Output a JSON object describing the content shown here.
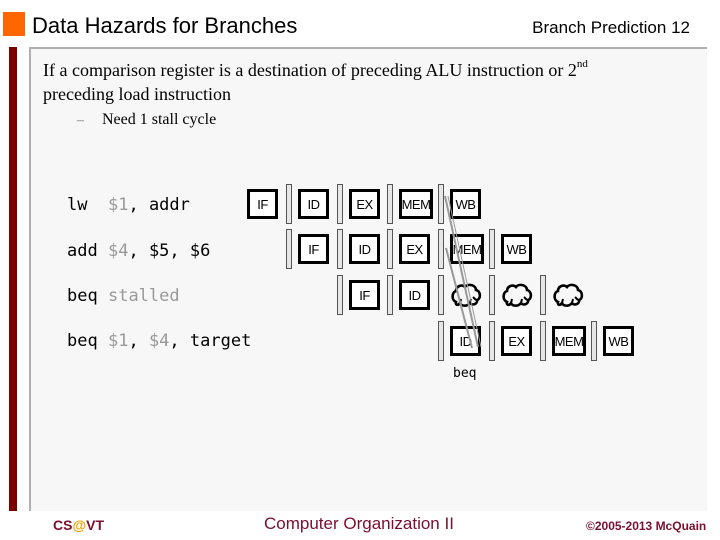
{
  "header": {
    "title": "Data Hazards for Branches",
    "section": "Branch Prediction",
    "slide_number": "12",
    "accent_color": "#ff6600",
    "bar_color": "#7a0000"
  },
  "body": {
    "bullet_line1_text": "If a comparison register is a destination of preceding ALU instruction or 2",
    "bullet_line1_sup": "nd",
    "bullet_line2": "preceding load instruction",
    "sub_dash": "–",
    "sub_bullet": "Need 1 stall cycle"
  },
  "instructions": [
    {
      "op": "lw",
      "args_gray": "$1",
      "sep1": ", ",
      "rest": "addr",
      "args2_gray": "",
      "tail": ""
    },
    {
      "op": "add",
      "args_gray": "$4",
      "sep1": ", ",
      "rest": "$5, $6",
      "args2_gray": "",
      "tail": ""
    },
    {
      "op": "beq",
      "args_gray": "stalled",
      "sep1": "",
      "rest": "",
      "args2_gray": "",
      "tail": ""
    },
    {
      "op": "beq",
      "args_gray": "$1",
      "sep1": ", ",
      "rest": "",
      "args2_gray": "$4",
      "tail": ", target"
    }
  ],
  "pipeline": {
    "rows": [
      {
        "stages": [
          "IF",
          "ID",
          "EX",
          "MEM",
          "WB"
        ]
      },
      {
        "stages": [
          "IF",
          "ID",
          "EX",
          "MEM",
          "WB"
        ]
      },
      {
        "stages": [
          "IF",
          "ID",
          "bubble",
          "bubble",
          "bubble"
        ]
      },
      {
        "stages": [
          "ID",
          "EX",
          "MEM",
          "WB"
        ]
      }
    ],
    "annotation": "beq"
  },
  "footer": {
    "left_prefix": "CS",
    "left_at": "@",
    "left_suffix": "VT",
    "center": "Computer Organization II",
    "right": "©2005-2013 McQuain"
  }
}
